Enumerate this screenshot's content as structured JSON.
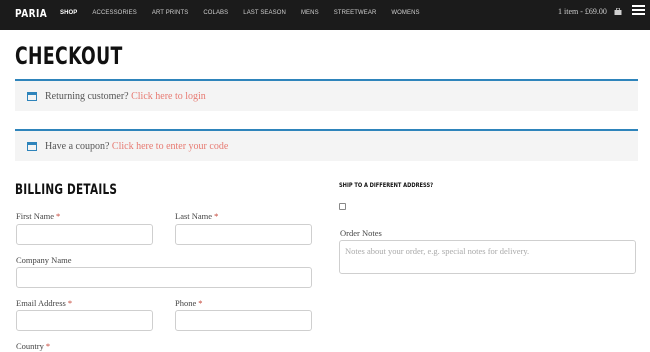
{
  "header": {
    "logo": "PARIA",
    "nav": [
      {
        "label": "Shop",
        "active": true
      },
      {
        "label": "Accessories",
        "active": false
      },
      {
        "label": "Art Prints",
        "active": false
      },
      {
        "label": "Colabs",
        "active": false
      },
      {
        "label": "Last Season",
        "active": false
      },
      {
        "label": "Mens",
        "active": false
      },
      {
        "label": "Streetwear",
        "active": false
      },
      {
        "label": "Womens",
        "active": false
      }
    ],
    "cart_text": "1 item - £69.00",
    "cart_icon": "shopping-bag-icon",
    "menu_icon": "hamburger-menu-icon"
  },
  "page": {
    "title": "CHECKOUT"
  },
  "notices": {
    "returning": {
      "text": "Returning customer? ",
      "link": "Click here to login",
      "icon": "window-icon"
    },
    "coupon": {
      "text": "Have a coupon? ",
      "link": "Click here to enter your code",
      "icon": "window-icon"
    }
  },
  "billing": {
    "title": "BILLING DETAILS",
    "required_mark": "*",
    "first_name_label": "First Name",
    "last_name_label": "Last Name",
    "company_label": "Company Name",
    "email_label": "Email Address",
    "phone_label": "Phone",
    "country_label": "Country"
  },
  "shipping": {
    "title": "Ship to a different address?",
    "order_notes_label": "Order Notes",
    "order_notes_placeholder": "Notes about your order, e.g. special notes for delivery."
  },
  "colors": {
    "accent": "#2e84bb",
    "link": "#e77a72",
    "header_bg": "#1b1b1b",
    "required": "#c0392b"
  }
}
